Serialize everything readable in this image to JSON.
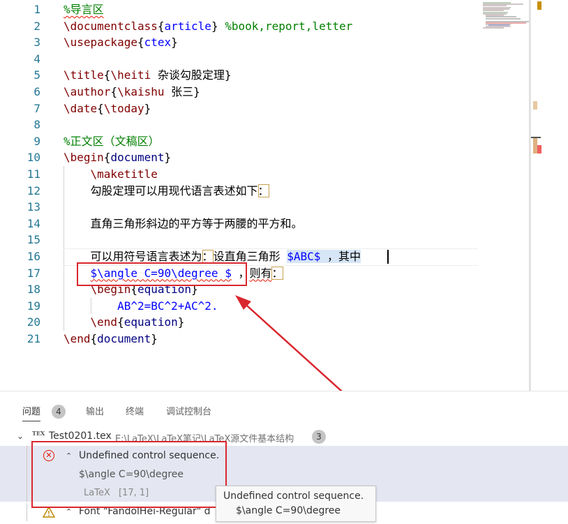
{
  "editor": {
    "lines": [
      {
        "n": "1",
        "segs": [
          {
            "t": "%导言区",
            "c": "cmt squiggle"
          }
        ]
      },
      {
        "n": "2",
        "segs": [
          {
            "t": "\\documentclass",
            "c": "cmd"
          },
          {
            "t": "{",
            "c": "plain"
          },
          {
            "t": "article",
            "c": "arg"
          },
          {
            "t": "} ",
            "c": "plain"
          },
          {
            "t": "%book,report,letter",
            "c": "cmt"
          }
        ]
      },
      {
        "n": "3",
        "segs": [
          {
            "t": "\\usepackage",
            "c": "cmd"
          },
          {
            "t": "{",
            "c": "plain"
          },
          {
            "t": "ctex",
            "c": "arg"
          },
          {
            "t": "}",
            "c": "plain"
          }
        ]
      },
      {
        "n": "4",
        "segs": []
      },
      {
        "n": "5",
        "segs": [
          {
            "t": "\\title",
            "c": "cmd"
          },
          {
            "t": "{",
            "c": "plain"
          },
          {
            "t": "\\heiti",
            "c": "cmd"
          },
          {
            "t": " 杂谈勾股定理}",
            "c": "plain"
          }
        ]
      },
      {
        "n": "6",
        "segs": [
          {
            "t": "\\author",
            "c": "cmd"
          },
          {
            "t": "{",
            "c": "plain"
          },
          {
            "t": "\\kaishu",
            "c": "cmd"
          },
          {
            "t": " 张三}",
            "c": "plain"
          }
        ]
      },
      {
        "n": "7",
        "segs": [
          {
            "t": "\\date",
            "c": "cmd"
          },
          {
            "t": "{",
            "c": "plain"
          },
          {
            "t": "\\today",
            "c": "cmd"
          },
          {
            "t": "}",
            "c": "plain"
          }
        ]
      },
      {
        "n": "8",
        "segs": []
      },
      {
        "n": "9",
        "segs": [
          {
            "t": "%正文区（文稿区）",
            "c": "cmt"
          }
        ]
      },
      {
        "n": "10",
        "segs": [
          {
            "t": "\\begin",
            "c": "kw"
          },
          {
            "t": "{",
            "c": "plain"
          },
          {
            "t": "document",
            "c": "env"
          },
          {
            "t": "}",
            "c": "plain"
          }
        ]
      },
      {
        "n": "11",
        "segs": [
          {
            "t": "    ",
            "c": "plain"
          },
          {
            "t": "\\maketitle",
            "c": "cmd"
          }
        ]
      },
      {
        "n": "12",
        "segs": [
          {
            "t": "    勾股定理可以用现代语言表述如下",
            "c": "plain"
          },
          {
            "t": "：",
            "c": "plain box-orange"
          }
        ]
      },
      {
        "n": "13",
        "segs": []
      },
      {
        "n": "14",
        "segs": [
          {
            "t": "    直角三角形斜边的平方等于两腰的平方和。",
            "c": "plain"
          }
        ]
      },
      {
        "n": "15",
        "segs": []
      },
      {
        "n": "16",
        "segs": [
          {
            "t": "    可以用符号语言表述为",
            "c": "plain"
          },
          {
            "t": "：",
            "c": "plain box-orange"
          },
          {
            "t": "设直角三角形 ",
            "c": "plain"
          },
          {
            "t": "$ABC$",
            "c": "math selection"
          },
          {
            "t": " ，其中",
            "c": "plain selection"
          }
        ]
      },
      {
        "n": "17",
        "segs": [
          {
            "t": "    ",
            "c": "plain"
          },
          {
            "t": "$\\angle C=90\\degree $",
            "c": "math squiggle"
          },
          {
            "t": " ，",
            "c": "plain"
          },
          {
            "t": "则有",
            "c": "plain squiggle"
          },
          {
            "t": "：",
            "c": "plain box-orange"
          }
        ]
      },
      {
        "n": "18",
        "segs": [
          {
            "t": "    ",
            "c": "plain"
          },
          {
            "t": "\\begin",
            "c": "kw"
          },
          {
            "t": "{",
            "c": "plain"
          },
          {
            "t": "equation",
            "c": "env"
          },
          {
            "t": "}",
            "c": "plain"
          }
        ]
      },
      {
        "n": "19",
        "segs": [
          {
            "t": "        ",
            "c": "plain"
          },
          {
            "t": "AB^2=BC^2+AC^2.",
            "c": "math"
          }
        ]
      },
      {
        "n": "20",
        "segs": [
          {
            "t": "    ",
            "c": "plain"
          },
          {
            "t": "\\end",
            "c": "kw"
          },
          {
            "t": "{",
            "c": "plain"
          },
          {
            "t": "equation",
            "c": "env"
          },
          {
            "t": "}",
            "c": "plain"
          }
        ]
      },
      {
        "n": "21",
        "segs": [
          {
            "t": "\\end",
            "c": "kw"
          },
          {
            "t": "{",
            "c": "plain"
          },
          {
            "t": "document",
            "c": "env"
          },
          {
            "t": "}",
            "c": "plain"
          }
        ]
      }
    ]
  },
  "panel": {
    "tabs": [
      {
        "label": "问题",
        "active": true
      },
      {
        "label": "输出",
        "active": false
      },
      {
        "label": "终端",
        "active": false
      },
      {
        "label": "调试控制台",
        "active": false
      }
    ],
    "problem_count": "4",
    "file": {
      "tex_icon": "TEX",
      "name": "Test0201.tex",
      "path": "E:\\LaTeX\\LaTeX笔记\\LaTeX源文件基本结构",
      "count": "3"
    },
    "error": {
      "title": "Undefined control sequence.",
      "detail": "$\\angle C=90\\degree",
      "source": "LaTeX",
      "location": "[17, 1]"
    },
    "warning": {
      "title": "Font \"FandolHei-Regular\" d"
    }
  },
  "tooltip": {
    "line1": "Undefined control sequence.",
    "line2": "$\\angle C=90\\degree"
  },
  "colors": {
    "error": "#e51400",
    "annotation": "#d9272e",
    "warning": "#bf8803"
  }
}
